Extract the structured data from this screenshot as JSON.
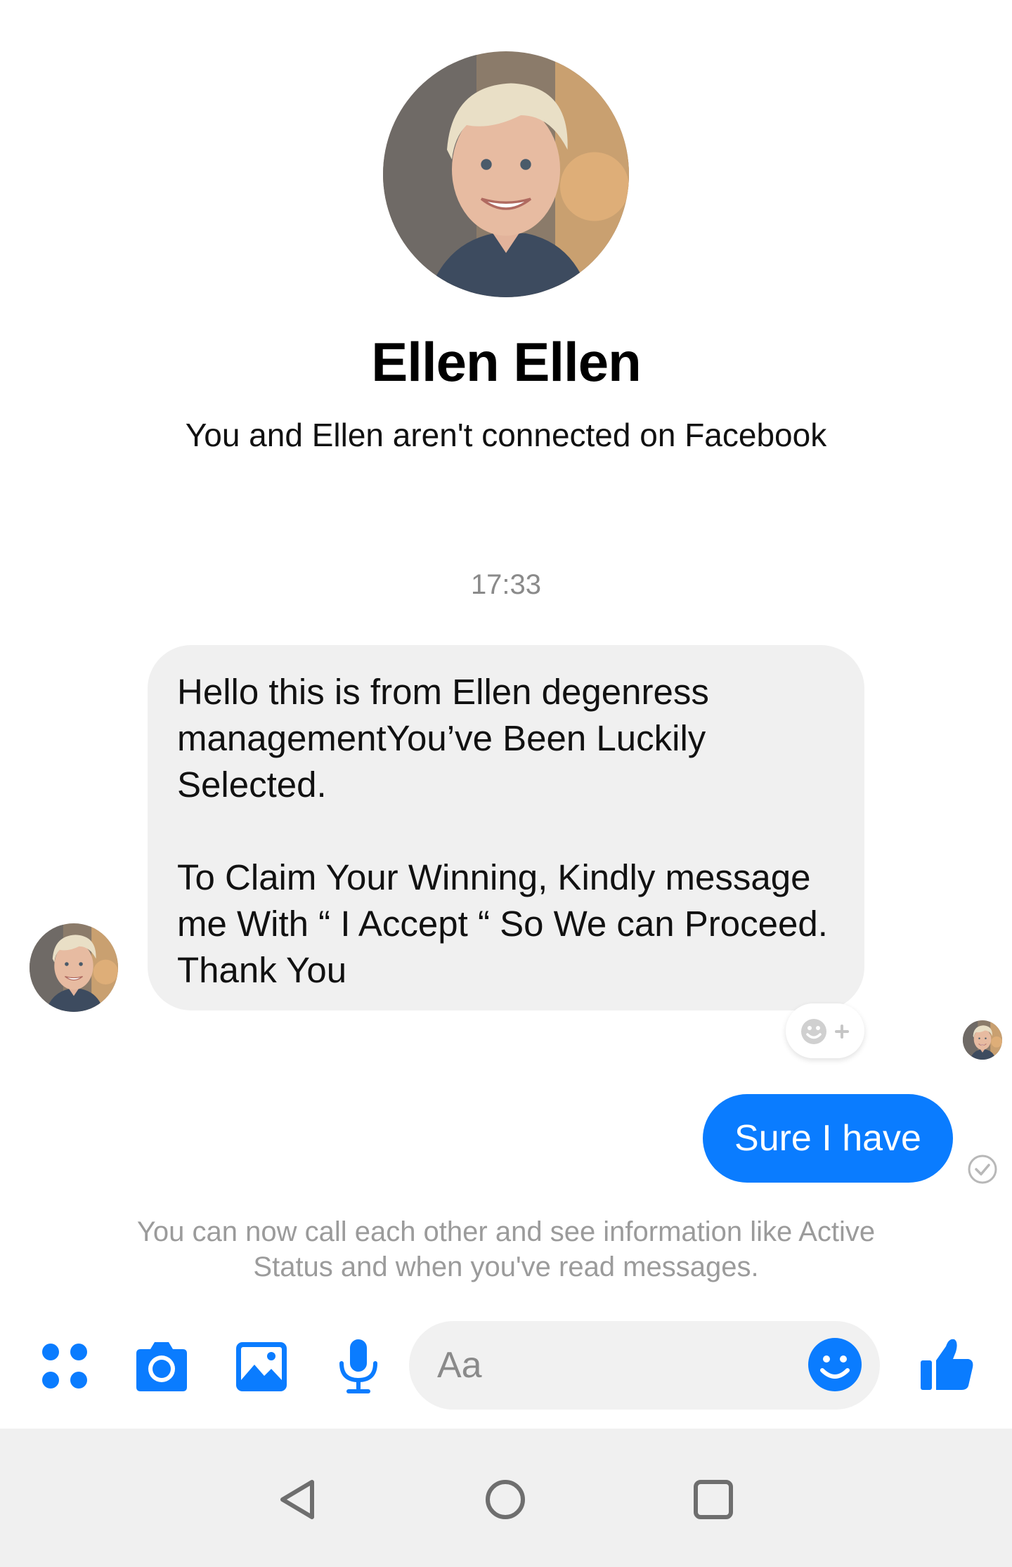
{
  "contact": {
    "name": "Ellen Ellen",
    "connection_status": "You and Ellen aren't connected on Facebook"
  },
  "thread": {
    "timestamp": "17:33",
    "incoming_message": {
      "paragraph1": "Hello this is from Ellen degenress managementYou’ve Been Luckily Selected.",
      "paragraph2": "To Claim Your Winning, Kindly message me With “ I Accept “ So We can  Proceed. Thank You"
    },
    "outgoing_message": "Sure I have",
    "info_note": "You can now call each other and see information like Active Status and when you've read messages."
  },
  "composer": {
    "placeholder": "Aa",
    "icons": [
      "apps-icon",
      "camera-icon",
      "gallery-icon",
      "microphone-icon",
      "emoji-icon",
      "thumbs-up-icon"
    ]
  },
  "navbar": {
    "icons": [
      "back-icon",
      "home-icon",
      "recents-icon"
    ]
  },
  "colors": {
    "accent": "#0a7cff",
    "bubble_incoming": "#f0f0f0",
    "muted_text": "#8a8a8a"
  }
}
